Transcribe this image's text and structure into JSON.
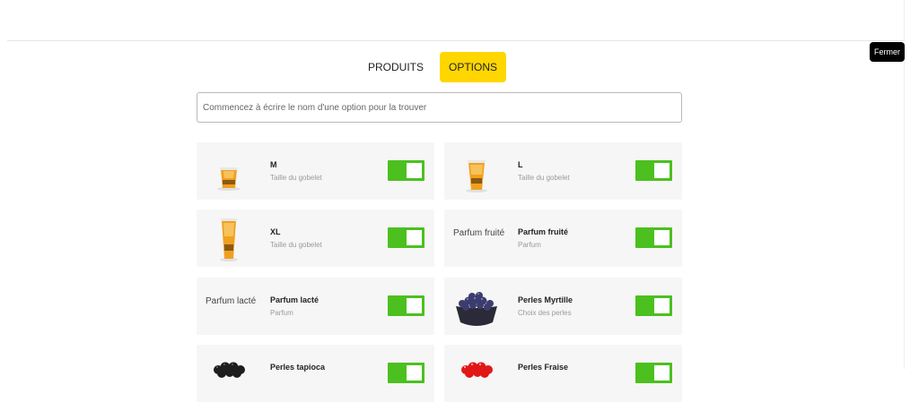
{
  "close_label": "Fermer",
  "tabs": [
    {
      "label": "PRODUITS",
      "active": false
    },
    {
      "label": "OPTIONS",
      "active": true
    }
  ],
  "search": {
    "placeholder": "Commencez à écrire le nom d'une option pour la trouver",
    "value": ""
  },
  "options": [
    {
      "name": "M",
      "sub": "Taille du gobelet",
      "thumb": "cup-small",
      "alt": "",
      "enabled": true
    },
    {
      "name": "L",
      "sub": "Taille du gobelet",
      "thumb": "cup-medium",
      "alt": "",
      "enabled": true
    },
    {
      "name": "XL",
      "sub": "Taille du gobelet",
      "thumb": "cup-large",
      "alt": "",
      "enabled": true
    },
    {
      "name": "Parfum fruité",
      "sub": "Parfum",
      "thumb": "broken",
      "alt": "Parfum fruité",
      "enabled": true
    },
    {
      "name": "Parfum lacté",
      "sub": "Parfum",
      "thumb": "broken",
      "alt": "Parfum lacté",
      "enabled": true
    },
    {
      "name": "Perles Myrtille",
      "sub": "Choix des perles",
      "thumb": "pearls-blue",
      "alt": "",
      "enabled": true
    },
    {
      "name": "Perles tapioca",
      "sub": "",
      "thumb": "pearls-black",
      "alt": "",
      "enabled": true
    },
    {
      "name": "Perles Fraise",
      "sub": "",
      "thumb": "pearls-red",
      "alt": "",
      "enabled": true
    }
  ],
  "colors": {
    "accent": "#ffd600",
    "toggle_on": "#4cc01f"
  }
}
